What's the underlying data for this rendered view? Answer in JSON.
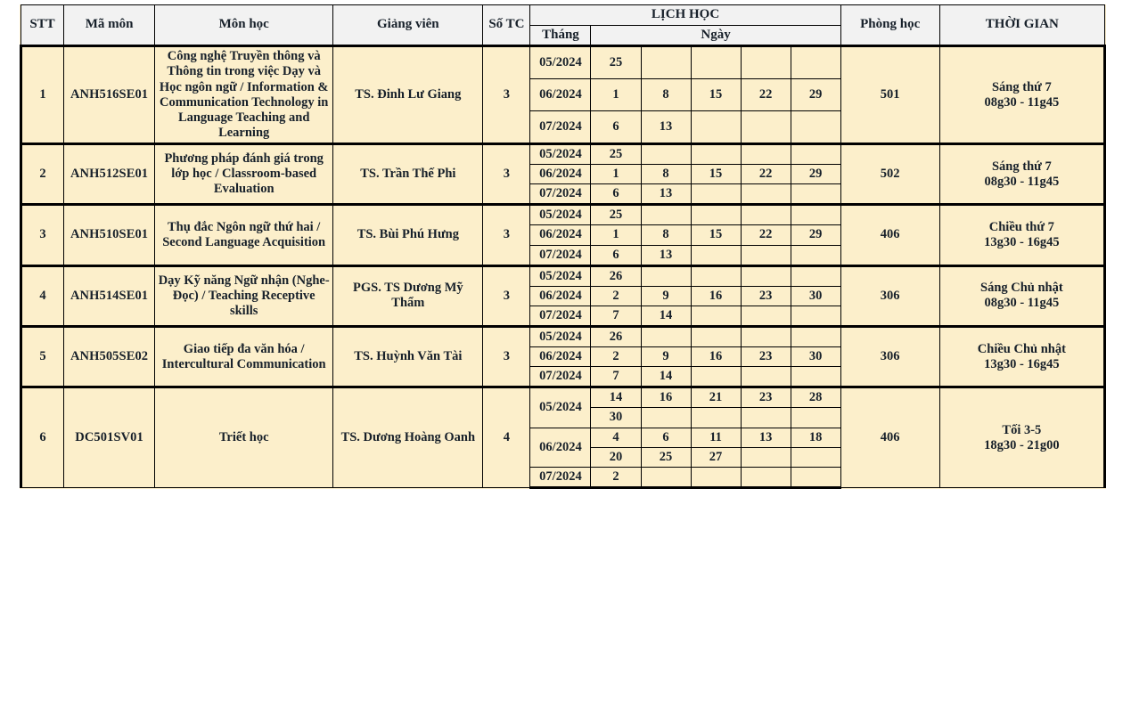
{
  "table": {
    "headers": {
      "stt": "STT",
      "code": "Mã môn",
      "subject": "Môn học",
      "teacher": "Giảng viên",
      "credit": "Số TC",
      "schedule_group": "LỊCH HỌC",
      "month": "Tháng",
      "day": "Ngày",
      "room": "Phòng học",
      "time": "THỜI GIAN"
    },
    "colors": {
      "cell_background": "#FCEFCB",
      "header_background": "#F2F2F2",
      "border": "#000000",
      "month_text": "#4472C4",
      "room_text": "#FF0000",
      "time_text": "#FF0000",
      "body_text": "#17202A"
    },
    "rows": [
      {
        "stt": "1",
        "code": "ANH516SE01",
        "subject": "Công nghệ Truyền thông và Thông tin trong việc Dạy và Học ngôn ngữ / Information & Communication Technology in Language Teaching and Learning",
        "teacher": "TS. Đinh Lư Giang",
        "credit": "3",
        "room": "501",
        "time_line1": "Sáng thứ 7",
        "time_line2": "08g30 - 11g45",
        "schedule": [
          {
            "month": "05/2024",
            "days": [
              "25",
              "",
              "",
              "",
              ""
            ]
          },
          {
            "month": "06/2024",
            "days": [
              "1",
              "8",
              "15",
              "22",
              "29"
            ]
          },
          {
            "month": "07/2024",
            "days": [
              "6",
              "13",
              "",
              "",
              ""
            ]
          }
        ]
      },
      {
        "stt": "2",
        "code": "ANH512SE01",
        "subject": "Phương pháp đánh giá trong lớp học / Classroom-based Evaluation",
        "teacher": "TS. Trần Thế Phi",
        "credit": "3",
        "room": "502",
        "time_line1": "Sáng thứ 7",
        "time_line2": "08g30 - 11g45",
        "schedule": [
          {
            "month": "05/2024",
            "days": [
              "25",
              "",
              "",
              "",
              ""
            ]
          },
          {
            "month": "06/2024",
            "days": [
              "1",
              "8",
              "15",
              "22",
              "29"
            ]
          },
          {
            "month": "07/2024",
            "days": [
              "6",
              "13",
              "",
              "",
              ""
            ]
          }
        ]
      },
      {
        "stt": "3",
        "code": "ANH510SE01",
        "subject": "Thụ đắc Ngôn ngữ thứ hai / Second Language Acquisition",
        "teacher": "TS. Bùi Phú Hưng",
        "credit": "3",
        "room": "406",
        "time_line1": "Chiều thứ 7",
        "time_line2": "13g30 - 16g45",
        "schedule": [
          {
            "month": "05/2024",
            "days": [
              "25",
              "",
              "",
              "",
              ""
            ]
          },
          {
            "month": "06/2024",
            "days": [
              "1",
              "8",
              "15",
              "22",
              "29"
            ]
          },
          {
            "month": "07/2024",
            "days": [
              "6",
              "13",
              "",
              "",
              ""
            ]
          }
        ]
      },
      {
        "stt": "4",
        "code": "ANH514SE01",
        "subject": "Dạy Kỹ năng Ngữ nhận (Nghe-Đọc) / Teaching Receptive skills",
        "teacher": "PGS. TS Dương Mỹ Thẩm",
        "credit": "3",
        "room": "306",
        "time_line1": "Sáng Chủ nhật",
        "time_line2": "08g30 - 11g45",
        "schedule": [
          {
            "month": "05/2024",
            "days": [
              "26",
              "",
              "",
              "",
              ""
            ]
          },
          {
            "month": "06/2024",
            "days": [
              "2",
              "9",
              "16",
              "23",
              "30"
            ]
          },
          {
            "month": "07/2024",
            "days": [
              "7",
              "14",
              "",
              "",
              ""
            ]
          }
        ]
      },
      {
        "stt": "5",
        "code": "ANH505SE02",
        "subject": "Giao tiếp đa văn hóa / Intercultural Communication",
        "teacher": "TS. Huỳnh Văn Tài",
        "credit": "3",
        "room": "306",
        "time_line1": "Chiều Chủ nhật",
        "time_line2": "13g30 - 16g45",
        "schedule": [
          {
            "month": "05/2024",
            "days": [
              "26",
              "",
              "",
              "",
              ""
            ]
          },
          {
            "month": "06/2024",
            "days": [
              "2",
              "9",
              "16",
              "23",
              "30"
            ]
          },
          {
            "month": "07/2024",
            "days": [
              "7",
              "14",
              "",
              "",
              ""
            ]
          }
        ]
      },
      {
        "stt": "6",
        "code": "DC501SV01",
        "subject": "Triết học",
        "teacher": "TS. Dương Hoàng Oanh",
        "credit": "4",
        "room": "406",
        "time_line1": "Tối 3-5",
        "time_line2": "18g30 - 21g00",
        "schedule": [
          {
            "month": "05/2024",
            "days": [
              "14",
              "16",
              "21",
              "23",
              "28"
            ]
          },
          {
            "month": "",
            "days": [
              "30",
              "",
              "",
              "",
              ""
            ]
          },
          {
            "month": "06/2024",
            "days": [
              "4",
              "6",
              "11",
              "13",
              "18"
            ]
          },
          {
            "month": "",
            "days": [
              "20",
              "25",
              "27",
              "",
              ""
            ]
          },
          {
            "month": "07/2024",
            "days": [
              "2",
              "",
              "",
              "",
              ""
            ]
          }
        ]
      }
    ]
  }
}
